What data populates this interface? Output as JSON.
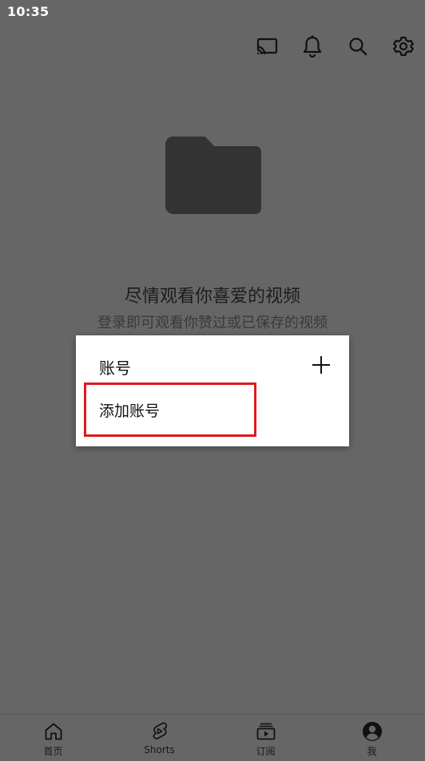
{
  "status_bar": {
    "time": "10:35"
  },
  "top_bar": {
    "icons": [
      "cast-icon",
      "bell-icon",
      "search-icon",
      "gear-icon"
    ]
  },
  "empty_state": {
    "icon": "folder-icon",
    "title": "尽情观看你喜爱的视频",
    "subtitle": "登录即可观看你赞过或已保存的视频"
  },
  "account_dialog": {
    "header_label": "账号",
    "add_icon": "plus-icon",
    "item_label": "添加账号",
    "highlight_color": "#e0191f"
  },
  "bottom_nav": {
    "items": [
      {
        "label": "首页",
        "icon": "home-icon"
      },
      {
        "label": "Shorts",
        "icon": "shorts-icon"
      },
      {
        "label": "订阅",
        "icon": "subscriptions-icon"
      },
      {
        "label": "我",
        "icon": "account-icon"
      }
    ]
  },
  "colors": {
    "background": "#666666",
    "dialog": "#ffffff",
    "folder": "#333333"
  }
}
